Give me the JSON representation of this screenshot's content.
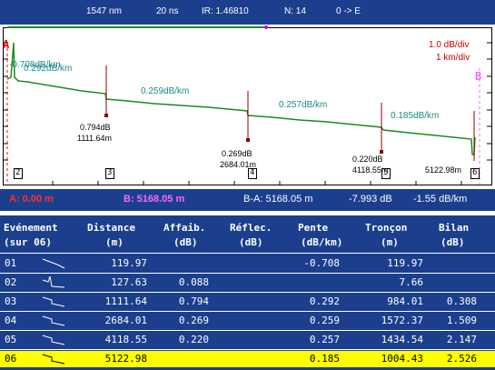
{
  "header": {
    "wavelength": "1547 nm",
    "pulse": "20 ns",
    "ir": "IR: 1.46810",
    "averages": "N: 14",
    "direction": "0 -> E"
  },
  "trace": {
    "marker_a_label": "A",
    "marker_b_label": "B",
    "scale_v": "1.0 dB/div",
    "scale_h": "1 km/div",
    "trace_color": "#1f8a1f",
    "slope_labels": [
      "-0.708dB/km",
      "0.292dB/km",
      "0.259dB/km",
      "0.257dB/km",
      "0.185dB/km"
    ],
    "events": [
      {
        "id": "2",
        "loss": "",
        "dist": ""
      },
      {
        "id": "3",
        "loss": "0.794dB",
        "dist": "1111.64m"
      },
      {
        "id": "4",
        "loss": "0.269dB",
        "dist": "2684.01m"
      },
      {
        "id": "5",
        "loss": "0.220dB",
        "dist": "4118.55m"
      },
      {
        "id": "6",
        "loss": "",
        "dist": "5122.98m"
      }
    ]
  },
  "status": {
    "pos_a": "A: 0.00 m",
    "pos_b": "B: 5168.05 m",
    "diff": "B-A: 5168.05 m",
    "loss": "-7.993 dB",
    "attn": "-1.55 dB/km"
  },
  "table": {
    "headers": {
      "event": [
        "Evénement",
        "(sur 06)"
      ],
      "distance": [
        "Distance",
        "(m)"
      ],
      "affaib": [
        "Affaib.",
        "(dB)"
      ],
      "reflec": [
        "Réflec.",
        "(dB)"
      ],
      "pente": [
        "Pente",
        "(dB/km)"
      ],
      "troncon": [
        "Tronçon",
        "(m)"
      ],
      "bilan": [
        "Bilan",
        "(dB)"
      ]
    },
    "rows": [
      {
        "id": "01",
        "icon": "slope-icon",
        "distance": "119.97",
        "affaib": "",
        "reflec": "",
        "pente": "-0.708",
        "troncon": "119.97",
        "bilan": ""
      },
      {
        "id": "02",
        "icon": "reflective-icon",
        "distance": "127.63",
        "affaib": "0.088",
        "reflec": "",
        "pente": "",
        "troncon": "7.66",
        "bilan": ""
      },
      {
        "id": "03",
        "icon": "step-icon",
        "distance": "1111.64",
        "affaib": "0.794",
        "reflec": "",
        "pente": "0.292",
        "troncon": "984.01",
        "bilan": "0.308"
      },
      {
        "id": "04",
        "icon": "step-icon",
        "distance": "2684.01",
        "affaib": "0.269",
        "reflec": "",
        "pente": "0.259",
        "troncon": "1572.37",
        "bilan": "1.509"
      },
      {
        "id": "05",
        "icon": "step-icon",
        "distance": "4118.55",
        "affaib": "0.220",
        "reflec": "",
        "pente": "0.257",
        "troncon": "1434.54",
        "bilan": "2.147"
      },
      {
        "id": "06",
        "icon": "step-icon",
        "distance": "5122.98",
        "affaib": "",
        "reflec": "",
        "pente": "0.185",
        "troncon": "1004.43",
        "bilan": "2.526"
      }
    ],
    "highlight_color": "#ffff00"
  }
}
